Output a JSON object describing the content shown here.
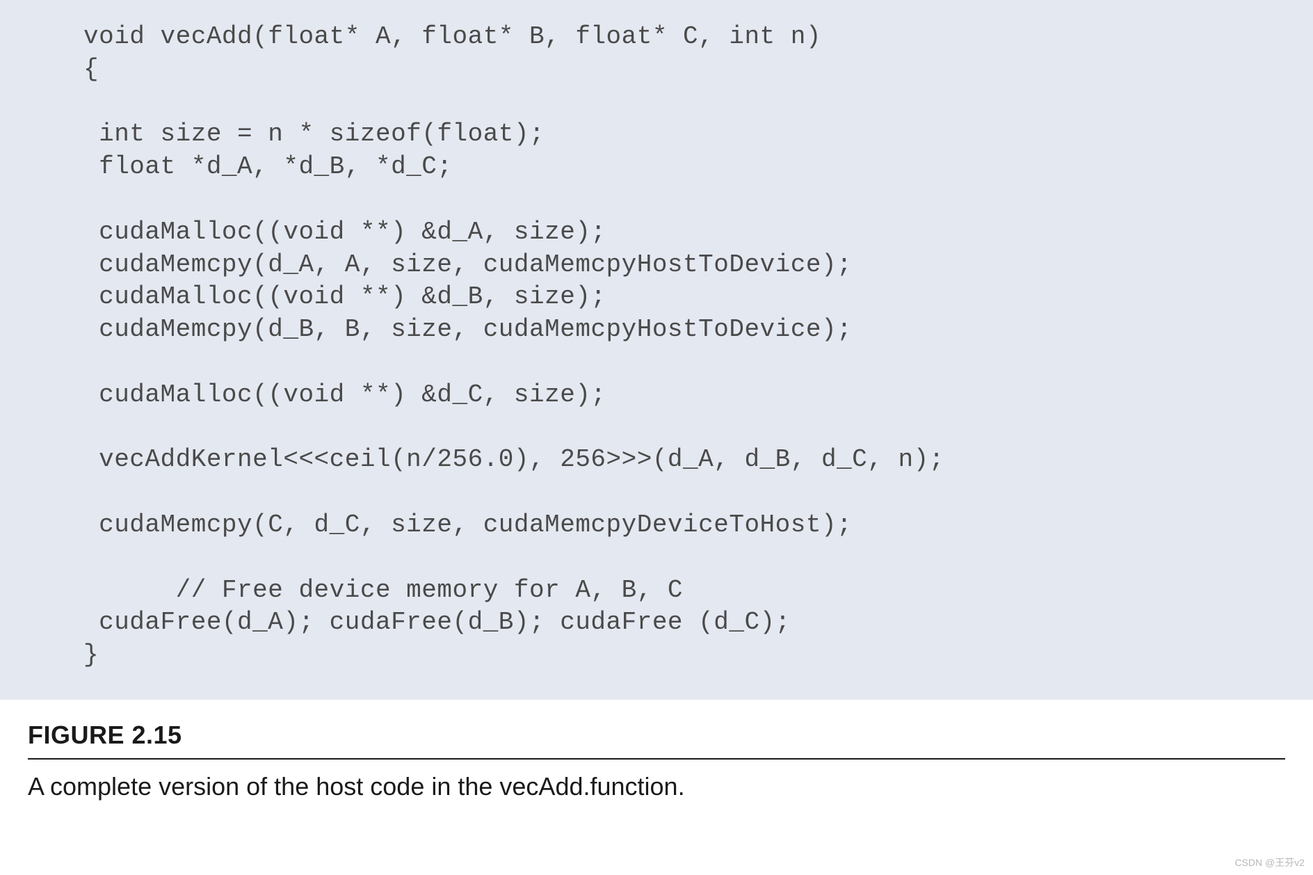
{
  "code": {
    "lines": [
      "void vecAdd(float* A, float* B, float* C, int n)",
      "{",
      "",
      " int size = n * sizeof(float);",
      " float *d_A, *d_B, *d_C;",
      "",
      " cudaMalloc((void **) &d_A, size);",
      " cudaMemcpy(d_A, A, size, cudaMemcpyHostToDevice);",
      " cudaMalloc((void **) &d_B, size);",
      " cudaMemcpy(d_B, B, size, cudaMemcpyHostToDevice);",
      "",
      " cudaMalloc((void **) &d_C, size);",
      "",
      " vecAddKernel<<<ceil(n/256.0), 256>>>(d_A, d_B, d_C, n);",
      "",
      " cudaMemcpy(C, d_C, size, cudaMemcpyDeviceToHost);",
      "",
      "      // Free device memory for A, B, C",
      " cudaFree(d_A); cudaFree(d_B); cudaFree (d_C);",
      "}"
    ]
  },
  "figure": {
    "label": "FIGURE 2.15",
    "caption": "A complete version of the host code in the vecAdd.function."
  },
  "watermark": "CSDN @王芬v2"
}
